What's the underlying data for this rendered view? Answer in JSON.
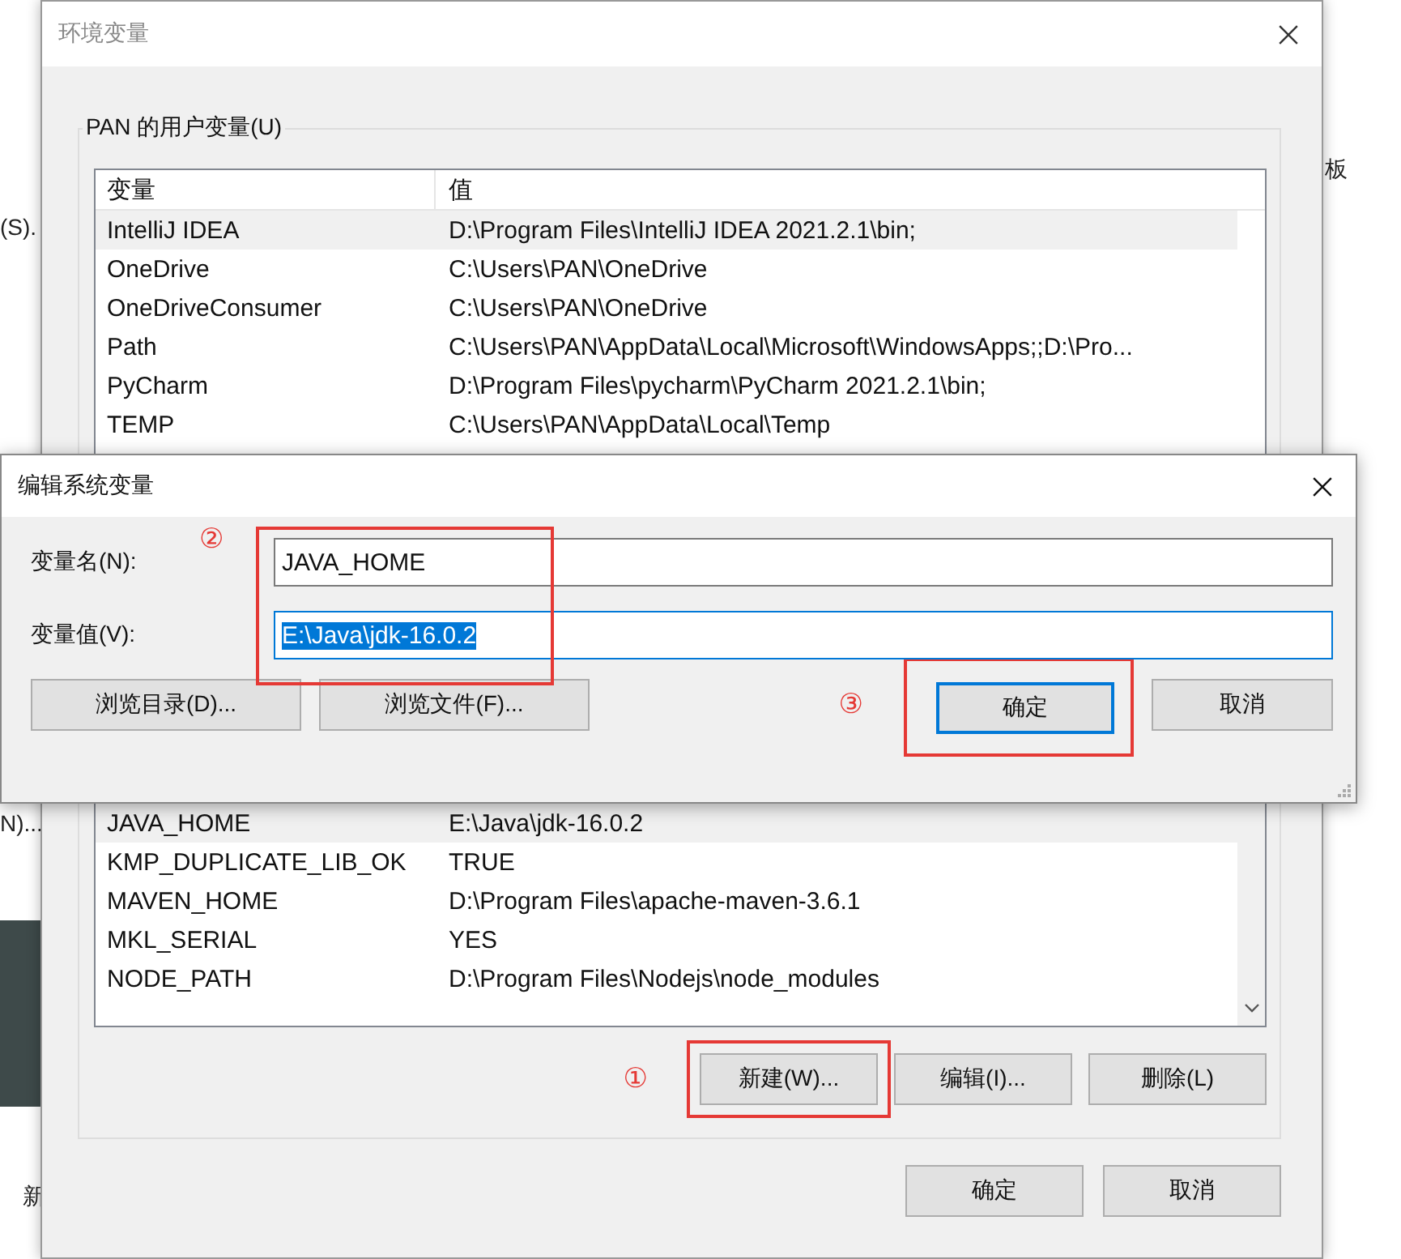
{
  "background": {
    "fragments": [
      "(S).",
      "N)...",
      "新",
      "板"
    ]
  },
  "env_window": {
    "title": "环境变量",
    "user_group": {
      "label": "PAN 的用户变量(U)",
      "columns": [
        "变量",
        "值"
      ],
      "rows": [
        {
          "name": "IntelliJ IDEA",
          "value": "D:\\Program Files\\IntelliJ IDEA 2021.2.1\\bin;",
          "selected": true
        },
        {
          "name": "OneDrive",
          "value": "C:\\Users\\PAN\\OneDrive",
          "selected": false
        },
        {
          "name": "OneDriveConsumer",
          "value": "C:\\Users\\PAN\\OneDrive",
          "selected": false
        },
        {
          "name": "Path",
          "value": "C:\\Users\\PAN\\AppData\\Local\\Microsoft\\WindowsApps;;D:\\Pro...",
          "selected": false
        },
        {
          "name": "PyCharm",
          "value": "D:\\Program Files\\pycharm\\PyCharm 2021.2.1\\bin;",
          "selected": false
        },
        {
          "name": "TEMP",
          "value": "C:\\Users\\PAN\\AppData\\Local\\Temp",
          "selected": false
        }
      ]
    },
    "system_group": {
      "rows": [
        {
          "name": "JAVA_HOME",
          "value": "E:\\Java\\jdk-16.0.2",
          "selected": true
        },
        {
          "name": "KMP_DUPLICATE_LIB_OK",
          "value": "TRUE",
          "selected": false
        },
        {
          "name": "MAVEN_HOME",
          "value": "D:\\Program Files\\apache-maven-3.6.1",
          "selected": false
        },
        {
          "name": "MKL_SERIAL",
          "value": "YES",
          "selected": false
        },
        {
          "name": "NODE_PATH",
          "value": "D:\\Program Files\\Nodejs\\node_modules",
          "selected": false
        }
      ],
      "step_mark": "①",
      "buttons": [
        "新建(W)...",
        "编辑(I)...",
        "删除(L)"
      ]
    },
    "buttons": [
      "确定",
      "取消"
    ]
  },
  "edit_dialog": {
    "title": "编辑系统变量",
    "step_mark_fields": "②",
    "step_mark_ok": "③",
    "name_label": "变量名(N):",
    "name_value": "JAVA_HOME",
    "value_label": "变量值(V):",
    "value_value": "E:\\Java\\jdk-16.0.2",
    "browse_buttons": [
      "浏览目录(D)...",
      "浏览文件(F)..."
    ],
    "ok": "确定",
    "cancel": "取消"
  }
}
